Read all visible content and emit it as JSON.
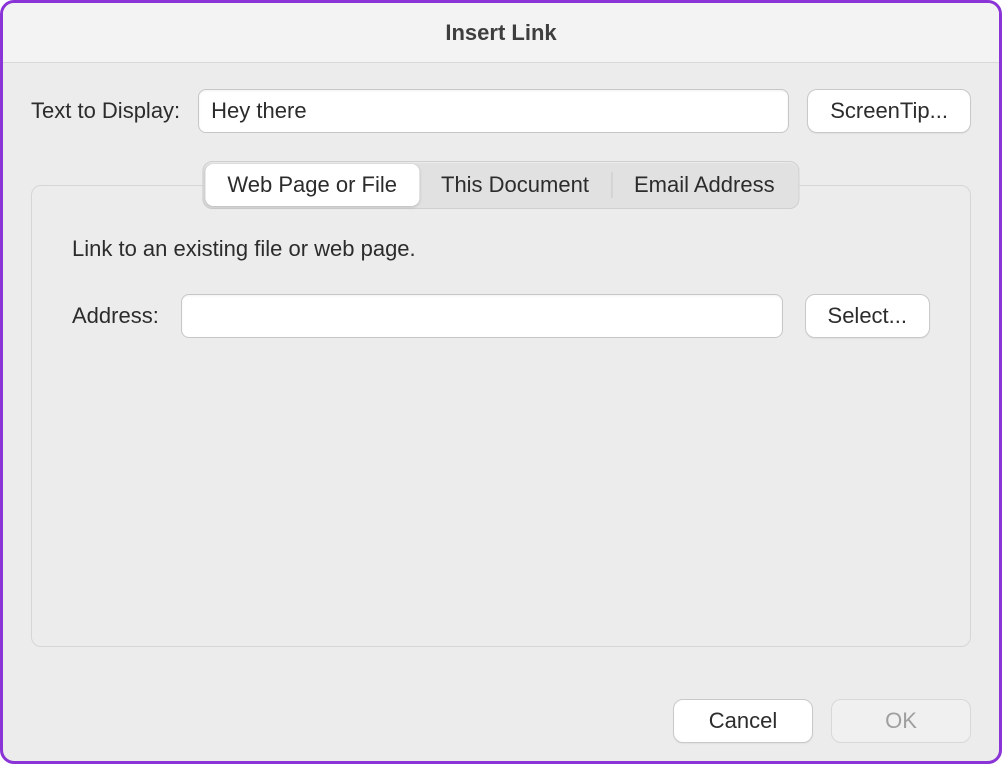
{
  "dialog": {
    "title": "Insert Link"
  },
  "text_to_display": {
    "label": "Text to Display:",
    "value": "Hey there"
  },
  "screentip": {
    "label": "ScreenTip..."
  },
  "tabs": {
    "web": "Web Page or File",
    "doc": "This Document",
    "email": "Email Address"
  },
  "panel": {
    "info": "Link to an existing file or web page.",
    "address_label": "Address:",
    "address_value": "",
    "select_label": "Select..."
  },
  "footer": {
    "cancel": "Cancel",
    "ok": "OK"
  }
}
